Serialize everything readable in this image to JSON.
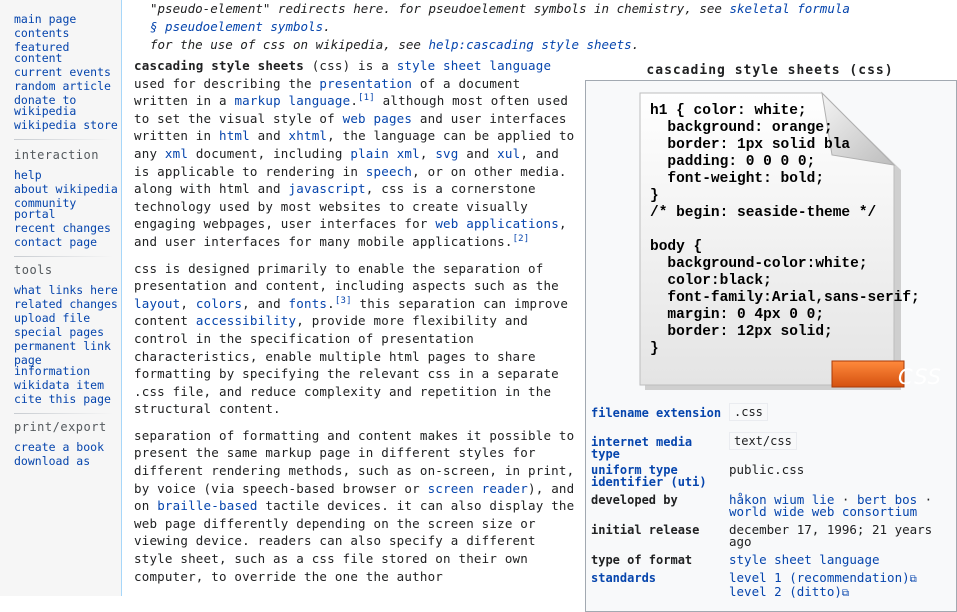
{
  "sidebar": {
    "nav": [
      "main page",
      "contents",
      "featured content",
      "current events",
      "random article",
      "donate to wikipedia",
      "wikipedia store"
    ],
    "interaction_heading": "interaction",
    "interaction": [
      "help",
      "about wikipedia",
      "community portal",
      "recent changes",
      "contact page"
    ],
    "tools_heading": "tools",
    "tools": [
      "what links here",
      "related changes",
      "upload file",
      "special pages",
      "permanent link",
      "page information",
      "wikidata item",
      "cite this page"
    ],
    "print_heading": "print/export",
    "print": [
      "create a book",
      "download as"
    ]
  },
  "hatnote": {
    "line1_text": "\"pseudo-element\" redirects here. for pseudoelement symbols in chemistry, see ",
    "line1_link": "skeletal formula",
    "line2_link": "§ pseudoelement symbols",
    "line2_end": ".",
    "line3_text": "for the use of css on wikipedia, see ",
    "line3_link": "help:cascading style sheets",
    "line3_end": "."
  },
  "article": {
    "p1": {
      "bold": "cascading style sheets",
      "t1": " (css) is a ",
      "l1": "style sheet language",
      "t2": " used for describing the ",
      "l2": "presentation",
      "t3": " of a document written in a ",
      "l3": "markup language",
      "ref1": "[1]",
      "t4": " although most often used to set the visual style of ",
      "l4": "web pages",
      "t5": " and user interfaces written in ",
      "l5": "html",
      "t6": " and ",
      "l6": "xhtml",
      "t7": ", the language can be applied to any ",
      "l7": "xml",
      "t8": " document, including ",
      "l8": "plain xml",
      "t9": ", ",
      "l9": "svg",
      "t10": " and ",
      "l10": "xul",
      "t11": ", and is applicable to rendering in ",
      "l11": "speech",
      "t12": ", or on other media. along with html and ",
      "l12": "javascript",
      "t13": ", css is a cornerstone technology used by most websites to create visually engaging webpages, user interfaces for ",
      "l13": "web applications",
      "t14": ", and user interfaces for many mobile applications.",
      "ref2": "[2]"
    },
    "p2": {
      "t1": "css is designed primarily to enable the separation of presentation and content, including aspects such as the ",
      "l1": "layout",
      "t2": ", ",
      "l2": "colors",
      "t3": ", and ",
      "l3": "fonts",
      "ref3": "[3]",
      "t4": " this separation can improve content ",
      "l4": "accessibility",
      "t5": ", provide more flexibility and control in the specification of presentation characteristics, enable multiple html pages to share formatting by specifying the relevant css in a separate .css file, and reduce complexity and repetition in the structural content."
    },
    "p3": {
      "t1": "separation of formatting and content makes it possible to present the same markup page in different styles for different rendering methods, such as on-screen, in print, by voice (via speech-based browser or ",
      "l1": "screen reader",
      "t2": "), and on ",
      "l2": "braille-based",
      "t3": " tactile devices. it can also display the web page differently depending on the screen size or viewing device. readers can also specify a different style sheet, such as a css file stored on their own computer, to override the one the author"
    }
  },
  "infobox": {
    "title": "cascading style sheets (css)",
    "code_sample": "h1 { color: white;\n  background: orange;\n  border: 1px solid bla\n  padding: 0 0 0 0;\n  font-weight: bold;\n}\n/* begin: seaside-theme */\n\nbody {\n  background-color:white;\n  color:black;\n  font-family:Arial,sans-serif;\n  margin: 0 4px 0 0;\n  border: 12px solid;\n}",
    "badge": "CSS",
    "rows": {
      "filename_label": "filename extension",
      "filename_value": ".css",
      "media_label": "internet media type",
      "media_value": "text/css",
      "uti_label": "uniform type identifier (uti)",
      "uti_value": "public.css",
      "dev_label": "developed by",
      "dev_1": "håkon wium lie",
      "dev_sep1": " · ",
      "dev_2": "bert bos",
      "dev_sep2": " · ",
      "dev_3": "world wide web consortium",
      "release_label": "initial release",
      "release_value": "december 17, 1996; 21 years ago",
      "format_label": "type of format",
      "format_value": "style sheet language",
      "standards_label": "standards",
      "standard_1": "level 1 (recommendation)",
      "standard_2": "level 2 (ditto)"
    }
  },
  "colors": {
    "link": "#0645ad",
    "badge_orange": "#e8601c",
    "sidebar_bg": "#f6f6f6",
    "infobox_bg": "#f8f9fa"
  }
}
